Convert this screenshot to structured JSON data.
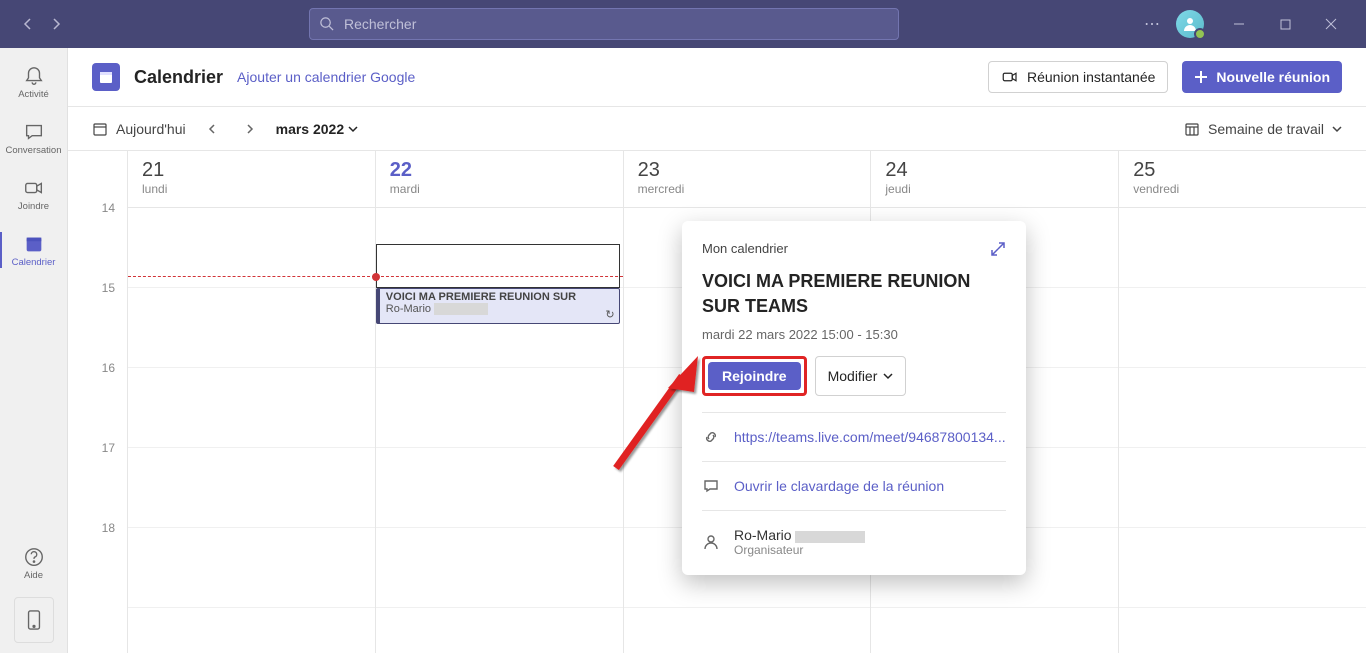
{
  "search": {
    "placeholder": "Rechercher"
  },
  "rail": {
    "activity": "Activité",
    "chat": "Conversation",
    "join": "Joindre",
    "calendar": "Calendrier",
    "help": "Aide"
  },
  "header": {
    "title": "Calendrier",
    "add_google": "Ajouter un calendrier Google",
    "instant": "Réunion instantanée",
    "new_meeting": "Nouvelle réunion"
  },
  "toolbar": {
    "today": "Aujourd'hui",
    "month": "mars 2022",
    "view": "Semaine de travail"
  },
  "days": [
    {
      "num": "21",
      "name": "lundi",
      "today": false
    },
    {
      "num": "22",
      "name": "mardi",
      "today": true
    },
    {
      "num": "23",
      "name": "mercredi",
      "today": false
    },
    {
      "num": "24",
      "name": "jeudi",
      "today": false
    },
    {
      "num": "25",
      "name": "vendredi",
      "today": false
    }
  ],
  "hours": [
    "14",
    "15",
    "16",
    "17",
    "18"
  ],
  "event": {
    "title": "VOICI MA PREMIERE REUNION SUR",
    "organizer": "Ro-Mario"
  },
  "popover": {
    "mycal": "Mon calendrier",
    "title": "VOICI MA PREMIERE REUNION SUR TEAMS",
    "time": "mardi 22 mars 2022 15:00 - 15:30",
    "join": "Rejoindre",
    "modify": "Modifier",
    "link": "https://teams.live.com/meet/94687800134...",
    "chat": "Ouvrir le clavardage de la réunion",
    "organizer_name": "Ro-Mario",
    "organizer_role": "Organisateur"
  },
  "colors": {
    "accent": "#5b5fc7",
    "headerbar": "#464775",
    "annotation": "#e02424"
  }
}
